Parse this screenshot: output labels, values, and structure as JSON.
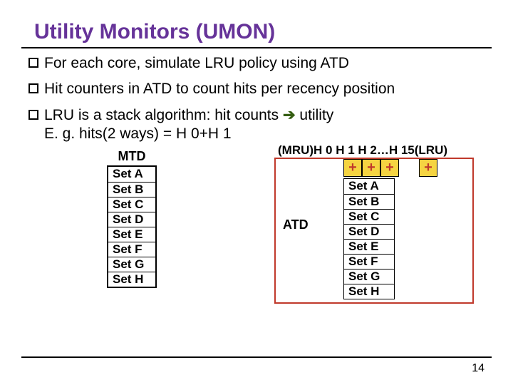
{
  "title": "Utility Monitors (UMON)",
  "bullets": [
    "For each core, simulate LRU policy using ATD",
    "Hit counters in ATD to count hits per recency position",
    "LRU is a stack algorithm: hit counts"
  ],
  "bullet3_tail": " utility",
  "bullet3_eg": "E. g. hits(2 ways) = H 0+H 1",
  "mtd": {
    "title": "MTD",
    "rows": [
      "Set A",
      "Set B",
      "Set C",
      "Set D",
      "Set E",
      "Set F",
      "Set G",
      "Set H"
    ]
  },
  "recency_header": "(MRU)H 0 H 1 H 2…H 15(LRU)",
  "plus_signs": [
    "+",
    "+",
    "+",
    "+"
  ],
  "atd": {
    "label": "ATD",
    "rows": [
      "Set A",
      "Set B",
      "Set C",
      "Set D",
      "Set E",
      "Set F",
      "Set G",
      "Set H"
    ]
  },
  "pagenum": "14"
}
